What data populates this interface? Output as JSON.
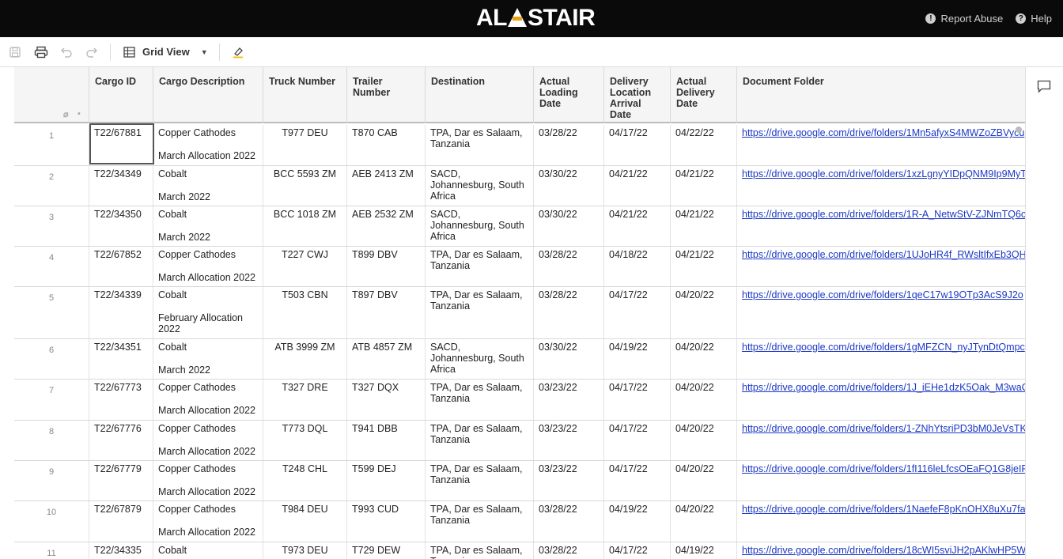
{
  "app": {
    "logo_text_left": "AL",
    "logo_text_right": "STAIR",
    "logo_small": "ALISTAIR",
    "report_abuse": "Report Abuse",
    "help": "Help"
  },
  "toolbar": {
    "view_label": "Grid View"
  },
  "columns": [
    "Cargo ID",
    "Cargo Description",
    "Truck Number",
    "Trailer Number",
    "Destination",
    "Actual Loading Date",
    "Delivery Location Arrival Date",
    "Actual Delivery Date",
    "Document Folder"
  ],
  "rows": [
    {
      "num": "1",
      "cargo_id": "T22/67881",
      "desc": "Copper Cathodes",
      "desc2": "March Allocation 2022",
      "truck": "T977 DEU",
      "trailer": "T870 CAB",
      "dest": "TPA, Dar es Salaam, Tanzania",
      "loading": "03/28/22",
      "arrival": "04/17/22",
      "delivery": "04/22/22",
      "folder": "https://drive.google.com/drive/folders/1Mn5afyxS4MWZoZBVycu"
    },
    {
      "num": "2",
      "cargo_id": "T22/34349",
      "desc": "Cobalt",
      "desc2": "March 2022",
      "truck": "BCC 5593 ZM",
      "trailer": "AEB 2413 ZM",
      "dest": "SACD, Johannesburg, South Africa",
      "loading": "03/30/22",
      "arrival": "04/21/22",
      "delivery": "04/21/22",
      "folder": "https://drive.google.com/drive/folders/1xzLgnyYIDpQNM9Ip9MyT"
    },
    {
      "num": "3",
      "cargo_id": "T22/34350",
      "desc": "Cobalt",
      "desc2": "March 2022",
      "truck": "BCC 1018 ZM",
      "trailer": "AEB 2532 ZM",
      "dest": "SACD, Johannesburg, South Africa",
      "loading": "03/30/22",
      "arrival": "04/21/22",
      "delivery": "04/21/22",
      "folder": "https://drive.google.com/drive/folders/1R-A_NetwStV-ZJNmTQ6c"
    },
    {
      "num": "4",
      "cargo_id": "T22/67852",
      "desc": "Copper Cathodes",
      "desc2": "March Allocation 2022",
      "truck": "T227 CWJ",
      "trailer": "T899 DBV",
      "dest": "TPA, Dar es Salaam, Tanzania",
      "loading": "03/28/22",
      "arrival": "04/18/22",
      "delivery": "04/21/22",
      "folder": "https://drive.google.com/drive/folders/1UJoHR4f_RWsltIfxEb3QH"
    },
    {
      "num": "5",
      "cargo_id": "T22/34339",
      "desc": "Cobalt",
      "desc2": "February Allocation 2022",
      "truck": "T503 CBN",
      "trailer": "T897 DBV",
      "dest": "TPA, Dar es Salaam, Tanzania",
      "loading": "03/28/22",
      "arrival": "04/17/22",
      "delivery": "04/20/22",
      "folder": "https://drive.google.com/drive/folders/1qeC17w19OTp3AcS9J2o"
    },
    {
      "num": "6",
      "cargo_id": "T22/34351",
      "desc": "Cobalt",
      "desc2": "March 2022",
      "truck": "ATB 3999 ZM",
      "trailer": "ATB 4857 ZM",
      "dest": "SACD, Johannesburg, South Africa",
      "loading": "03/30/22",
      "arrival": "04/19/22",
      "delivery": "04/20/22",
      "folder": "https://drive.google.com/drive/folders/1gMFZCN_nyJTynDtQmpc"
    },
    {
      "num": "7",
      "cargo_id": "T22/67773",
      "desc": "Copper Cathodes",
      "desc2": "March Allocation 2022",
      "truck": "T327 DRE",
      "trailer": "T327 DQX",
      "dest": "TPA, Dar es Salaam, Tanzania",
      "loading": "03/23/22",
      "arrival": "04/17/22",
      "delivery": "04/20/22",
      "folder": "https://drive.google.com/drive/folders/1J_iEHe1dzK5Oak_M3waC"
    },
    {
      "num": "8",
      "cargo_id": "T22/67776",
      "desc": "Copper Cathodes",
      "desc2": "March Allocation 2022",
      "truck": "T773 DQL",
      "trailer": "T941 DBB",
      "dest": "TPA, Dar es Salaam, Tanzania",
      "loading": "03/23/22",
      "arrival": "04/17/22",
      "delivery": "04/20/22",
      "folder": "https://drive.google.com/drive/folders/1-ZNhYtsriPD3bM0JeVsTK"
    },
    {
      "num": "9",
      "cargo_id": "T22/67779",
      "desc": "Copper Cathodes",
      "desc2": "March Allocation 2022",
      "truck": "T248 CHL",
      "trailer": "T599 DEJ",
      "dest": "TPA, Dar es Salaam, Tanzania",
      "loading": "03/23/22",
      "arrival": "04/17/22",
      "delivery": "04/20/22",
      "folder": "https://drive.google.com/drive/folders/1fI116leLfcsOEaFQ1G8jeIF"
    },
    {
      "num": "10",
      "cargo_id": "T22/67879",
      "desc": "Copper Cathodes",
      "desc2": "March Allocation 2022",
      "truck": "T984 DEU",
      "trailer": "T993 CUD",
      "dest": "TPA, Dar es Salaam, Tanzania",
      "loading": "03/28/22",
      "arrival": "04/19/22",
      "delivery": "04/20/22",
      "folder": "https://drive.google.com/drive/folders/1NaefeF8pKnOHX8uXu7fa"
    },
    {
      "num": "11",
      "cargo_id": "T22/34335",
      "desc": "Cobalt",
      "desc2": "",
      "truck": "T973 DEU",
      "trailer": "T729 DEW",
      "dest": "TPA, Dar es Salaam, Tanzania",
      "loading": "03/28/22",
      "arrival": "04/17/22",
      "delivery": "04/19/22",
      "folder": "https://drive.google.com/drive/folders/18cWI5sviJH2pAKlwHP5W"
    }
  ]
}
